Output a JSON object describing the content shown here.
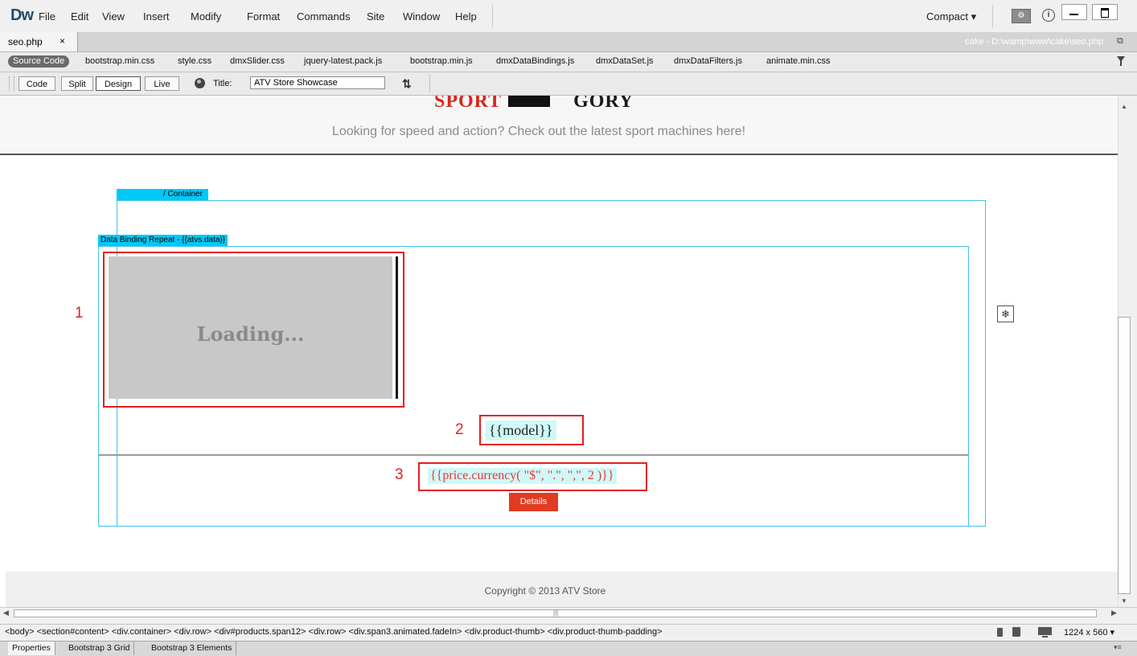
{
  "app": {
    "logo": "Dw"
  },
  "menu": [
    "File",
    "Edit",
    "View",
    "Insert",
    "Modify",
    "Format",
    "Commands",
    "Site",
    "Window",
    "Help"
  ],
  "workspace": {
    "layout": "Compact ▾"
  },
  "document": {
    "tab_label": "seo.php",
    "tab_close": "×",
    "path": "cake - D:\\wamp\\www\\cake\\seo.php"
  },
  "related_files": {
    "source_code": "Source Code",
    "files": [
      "bootstrap.min.css",
      "style.css",
      "dmxSlider.css",
      "jquery-latest.pack.js",
      "bootstrap.min.js",
      "dmxDataBindings.js",
      "dmxDataSet.js",
      "dmxDataFilters.js",
      "animate.min.css"
    ]
  },
  "toolbar": {
    "views": [
      "Code",
      "Split",
      "Design",
      "Live"
    ],
    "active_view": "Design",
    "title_label": "Title:",
    "title_value": "ATV Store Showcase"
  },
  "design": {
    "hero_title_left": "SPORT C",
    "hero_title_right": "GORY",
    "hero_subtitle": "Looking for speed and action? Check out the latest sport machines here!",
    "container_tag": "/ Container",
    "repeat_tag": "Data Binding Repeat - {{atvs.data}}",
    "loading": "Loading...",
    "annotations": [
      "1",
      "2",
      "3"
    ],
    "model": "{{model}}",
    "price": "{{price.currency( \"$\", \".\", \",\", 2 )}}",
    "details": "Details",
    "footer": "Copyright © 2013 ATV Store",
    "colors": {
      "accent_red": "#e13b23",
      "binding_bg": "#d0f8f8",
      "container_blue": "#00c8f8",
      "annotation_red": "#e31e1e"
    }
  },
  "tag_selector": "<body> <section#content> <div.container> <div.row> <div#products.span12> <div.row> <div.span3.animated.fadeIn> <div.product-thumb> <div.product-thumb-padding>",
  "viewport": "1224 x 560 ▾",
  "panels": [
    "Properties",
    "Bootstrap 3 Grid",
    "Bootstrap 3 Elements"
  ],
  "icons": [
    "globe-icon",
    "refresh-icon",
    "filter-icon",
    "info-icon",
    "sync-icon",
    "phone-icon",
    "tablet-icon",
    "desktop-icon"
  ]
}
